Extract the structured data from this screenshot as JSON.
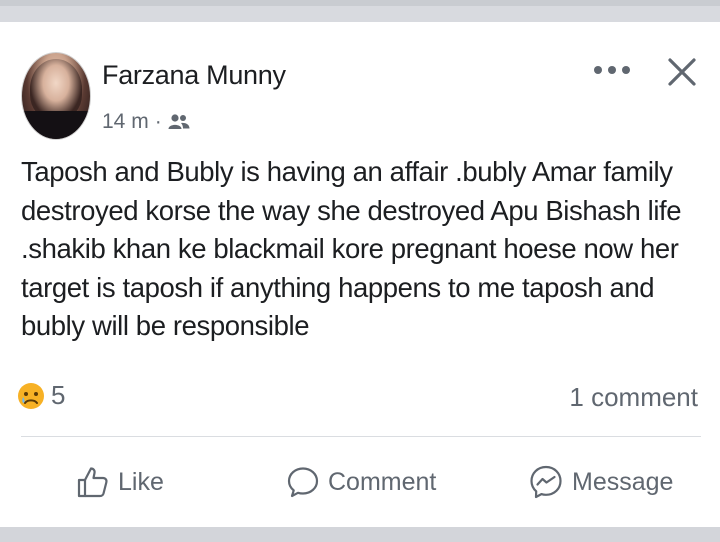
{
  "post": {
    "author": "Farzana Munny",
    "time": "14 m",
    "separator": "·",
    "audience_icon": "friends-icon",
    "text": "Taposh and Bubly is having an affair .bubly Amar family destroyed korse the way she destroyed Apu Bishash life .shakib khan ke blackmail kore pregnant hoese now her target is taposh if anything happens to me taposh and bubly will be responsible",
    "reactions": {
      "emoji": "sad-reaction-icon",
      "count": "5"
    },
    "comments": "1 comment",
    "actions": {
      "like": "Like",
      "comment": "Comment",
      "message": "Message"
    }
  },
  "colors": {
    "text": "#1c1e21",
    "secondary": "#606770",
    "divider": "#dadde1",
    "band": "#d3d5da"
  }
}
